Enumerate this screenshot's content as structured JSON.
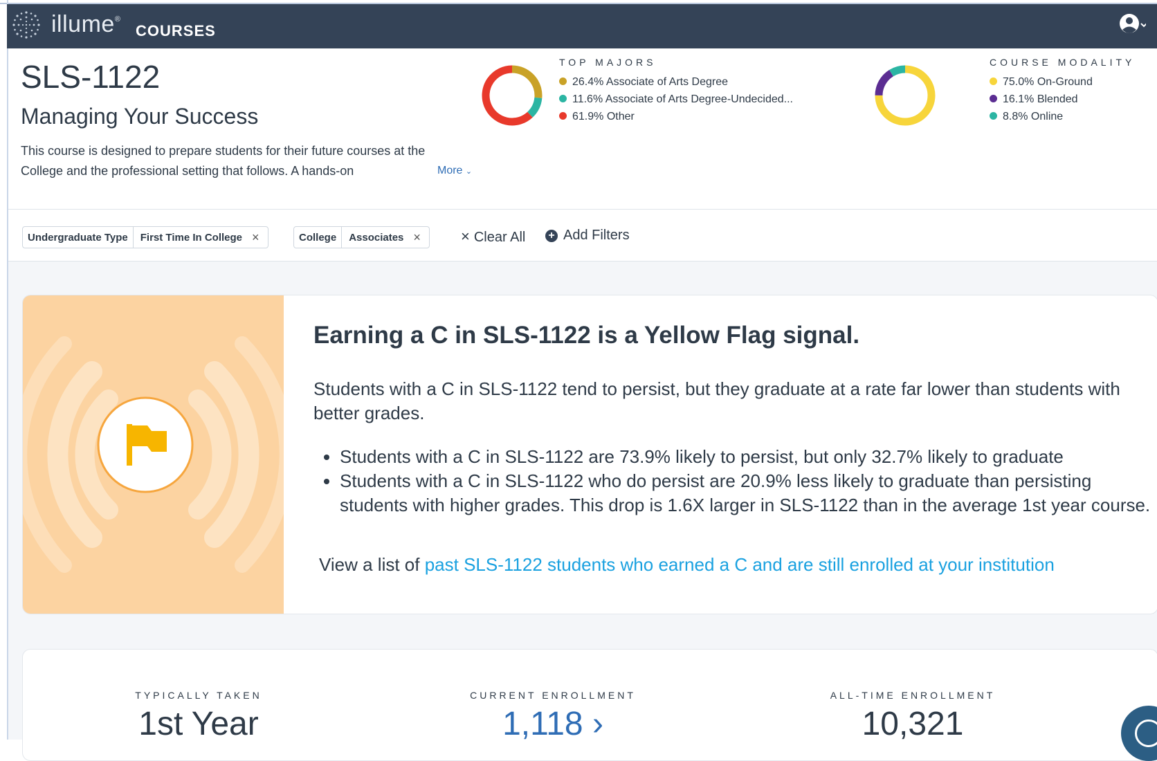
{
  "app": {
    "logo_word": "illume",
    "logo_reg": "®",
    "logo_product": "COURSES"
  },
  "course": {
    "code": "SLS-1122",
    "name": "Managing Your Success",
    "description": "This course is designed to prepare students for their future courses at the College and the professional setting that follows. A hands-on",
    "more_label": "More",
    "more_chevron": "⌄"
  },
  "top_majors": {
    "title": "TOP MAJORS",
    "items": [
      {
        "label": "26.4% Associate of Arts Degree",
        "value": 26.4,
        "color": "#c9a227"
      },
      {
        "label": "11.6% Associate of Arts Degree-Undecided...",
        "value": 11.6,
        "color": "#2bb5a3"
      },
      {
        "label": "61.9% Other",
        "value": 61.9,
        "color": "#e8392b"
      }
    ]
  },
  "course_modality": {
    "title": "COURSE MODALITY",
    "items": [
      {
        "label": "75.0% On-Ground",
        "value": 75.0,
        "color": "#f7d53b"
      },
      {
        "label": "16.1% Blended",
        "value": 16.1,
        "color": "#5b2d92"
      },
      {
        "label": "8.8% Online",
        "value": 8.8,
        "color": "#2bb5a3"
      }
    ]
  },
  "filters": {
    "chips": [
      {
        "key": "Undergraduate Type",
        "value": "First Time In College",
        "remove": "×"
      },
      {
        "key": "College",
        "value": "Associates",
        "remove": "×"
      }
    ],
    "clear_all_icon": "×",
    "clear_all_label": "Clear All",
    "add_icon": "+",
    "add_label": "Add Filters"
  },
  "signal": {
    "title": "Earning a C in SLS-1122 is a Yellow Flag signal.",
    "description": "Students with a C in SLS-1122 tend to persist, but they graduate at a rate far lower than students with better grades.",
    "bullets": [
      "Students with a C in SLS-1122 are 73.9% likely to persist, but only 32.7% likely to graduate",
      "Students with a C in SLS-1122 who do persist are 20.9% less likely to graduate than persisting students with higher grades. This drop is 1.6X larger in SLS-1122 than in the average 1st year course."
    ],
    "cta_prefix": "View a list of",
    "cta_link": "past SLS-1122 students who earned a C and are still enrolled at your institution",
    "flag_color": "#f7b500",
    "panel_color": "#fcd3a1"
  },
  "stats": [
    {
      "label": "TYPICALLY TAKEN",
      "value": "1st Year"
    },
    {
      "label": "CURRENT ENROLLMENT",
      "value": "1,118 ›"
    },
    {
      "label": "ALL-TIME ENROLLMENT",
      "value": "10,321"
    }
  ],
  "colors": {
    "topbar": "#344357",
    "link": "#2f6db5",
    "signal_link": "#1aa1e0"
  }
}
